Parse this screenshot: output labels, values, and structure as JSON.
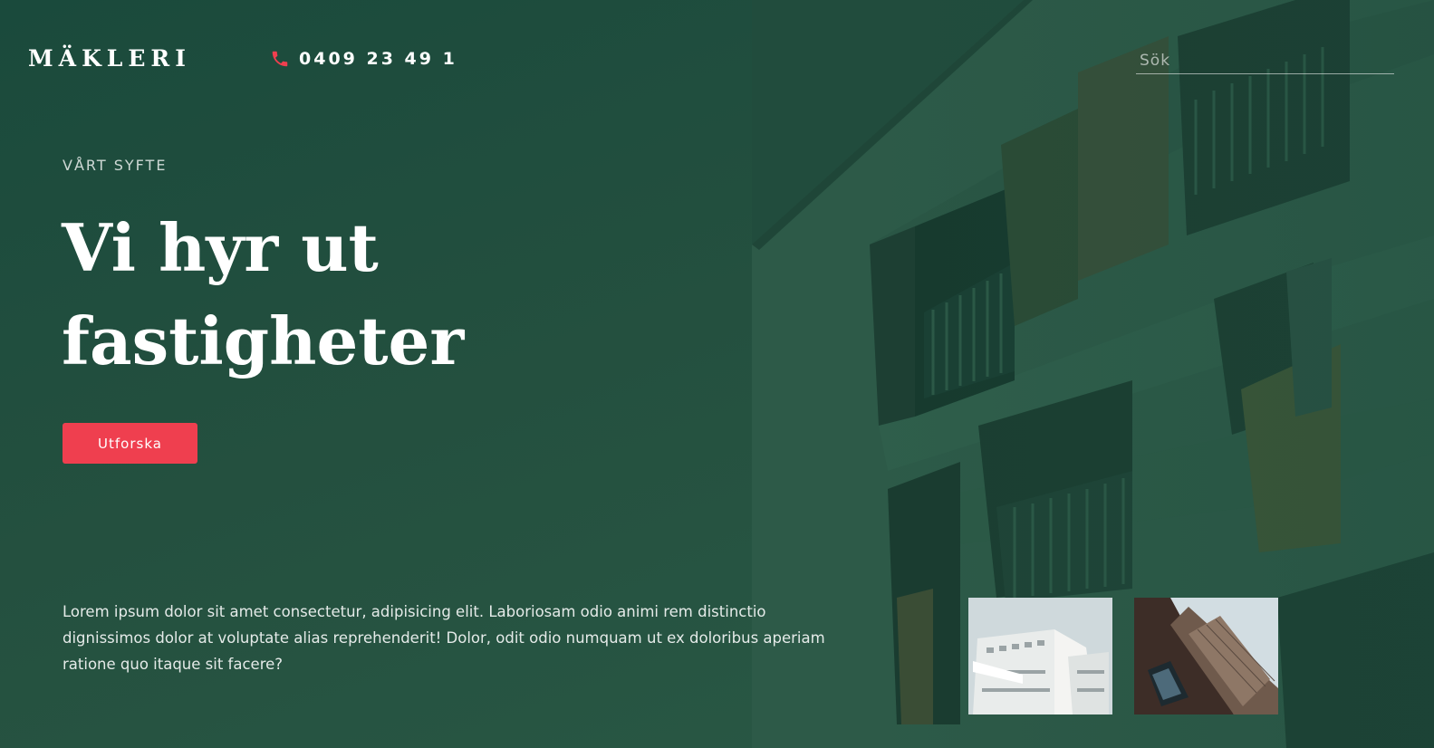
{
  "header": {
    "logo": "MÄKLERI",
    "phone": "0409 23 49 1",
    "phone_icon": "phone-icon",
    "search_placeholder": "Sök"
  },
  "hero": {
    "eyebrow": "VÅRT SYFTE",
    "headline": "Vi hyr ut fastigheter",
    "cta_label": "Utforska",
    "description": "Lorem ipsum dolor sit amet consectetur, adipisicing elit. Laboriosam odio animi rem distinctio dignissimos dolor at voluptate alias reprehenderit! Dolor, odit odio numquam ut ex doloribus aperiam ratione quo itaque sit facere?"
  },
  "colors": {
    "accent": "#ef3f4f",
    "background": "#23493a",
    "text": "#ffffff"
  },
  "thumbnails": [
    {
      "icon": "white-building-photo"
    },
    {
      "icon": "brick-building-photo"
    }
  ]
}
